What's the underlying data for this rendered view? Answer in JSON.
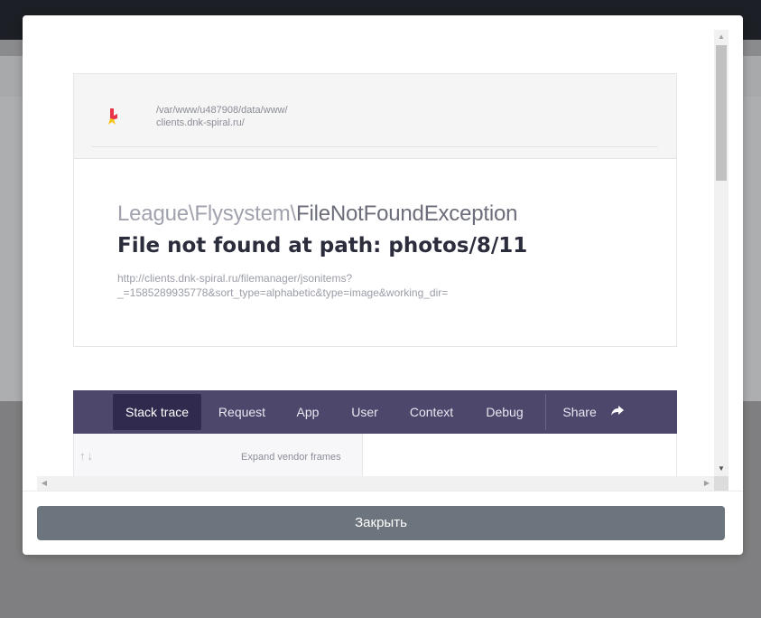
{
  "error_page": {
    "path_line1": "/var/www/u487908/data/www/",
    "path_line2": "clients.dnk-spiral.ru/",
    "exception_namespace": "League\\Flysystem\\",
    "exception_class": "FileNotFoundException",
    "message": "File not found at path: photos/8/11",
    "url_line1": "http://clients.dnk-spiral.ru/filemanager/jsonitems?",
    "url_line2": "_=1585289935778&sort_type=alphabetic&type=image&working_dir=",
    "tabs": [
      {
        "label": "Stack trace",
        "active": true
      },
      {
        "label": "Request",
        "active": false
      },
      {
        "label": "App",
        "active": false
      },
      {
        "label": "User",
        "active": false
      },
      {
        "label": "Context",
        "active": false
      },
      {
        "label": "Debug",
        "active": false
      }
    ],
    "share_label": "Share",
    "expand_vendor_label": "Expand vendor frames"
  },
  "footer": {
    "close_label": "Закрыть"
  },
  "colors": {
    "tabbar": "#4c476b",
    "tab_active": "#302b4e",
    "close_button": "#6c757d",
    "logo_red": "#e8334a",
    "logo_yellow": "#f5c518"
  }
}
